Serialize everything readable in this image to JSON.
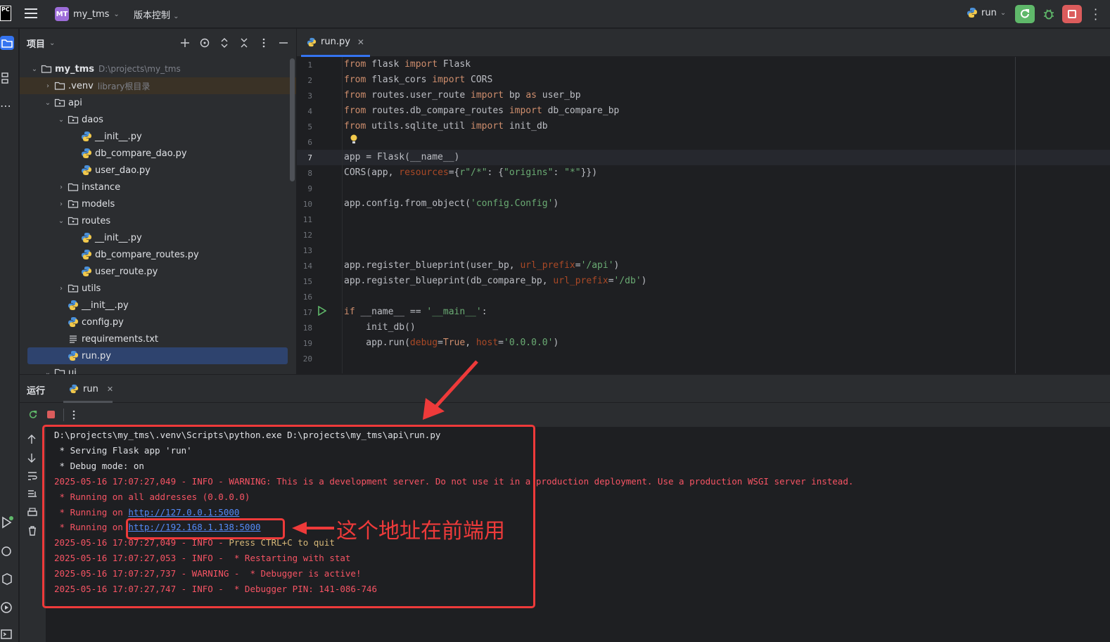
{
  "titlebar": {
    "logo": "PC",
    "project_badge": "MT",
    "project_name": "my_tms",
    "vcs_label": "版本控制",
    "run_config": "run"
  },
  "project_panel": {
    "title": "项目",
    "tree": [
      {
        "label": "my_tms",
        "hint": "D:\\projects\\my_tms",
        "depth": 0,
        "type": "folder",
        "open": true,
        "bold": true
      },
      {
        "label": ".venv",
        "hint": "library根目录",
        "depth": 1,
        "type": "folder",
        "open": false
      },
      {
        "label": "api",
        "hint": "",
        "depth": 1,
        "type": "package",
        "open": true
      },
      {
        "label": "daos",
        "hint": "",
        "depth": 2,
        "type": "package",
        "open": true
      },
      {
        "label": "__init__.py",
        "hint": "",
        "depth": 3,
        "type": "py"
      },
      {
        "label": "db_compare_dao.py",
        "hint": "",
        "depth": 3,
        "type": "py"
      },
      {
        "label": "user_dao.py",
        "hint": "",
        "depth": 3,
        "type": "py"
      },
      {
        "label": "instance",
        "hint": "",
        "depth": 2,
        "type": "folder",
        "open": false
      },
      {
        "label": "models",
        "hint": "",
        "depth": 2,
        "type": "package",
        "open": false
      },
      {
        "label": "routes",
        "hint": "",
        "depth": 2,
        "type": "package",
        "open": true
      },
      {
        "label": "__init__.py",
        "hint": "",
        "depth": 3,
        "type": "py"
      },
      {
        "label": "db_compare_routes.py",
        "hint": "",
        "depth": 3,
        "type": "py"
      },
      {
        "label": "user_route.py",
        "hint": "",
        "depth": 3,
        "type": "py"
      },
      {
        "label": "utils",
        "hint": "",
        "depth": 2,
        "type": "package",
        "open": false
      },
      {
        "label": "__init__.py",
        "hint": "",
        "depth": 2,
        "type": "py"
      },
      {
        "label": "config.py",
        "hint": "",
        "depth": 2,
        "type": "py"
      },
      {
        "label": "requirements.txt",
        "hint": "",
        "depth": 2,
        "type": "txt"
      },
      {
        "label": "run.py",
        "hint": "",
        "depth": 2,
        "type": "py",
        "selected": true
      },
      {
        "label": "ui",
        "hint": "",
        "depth": 1,
        "type": "folder",
        "open": true
      }
    ]
  },
  "editor": {
    "tab_label": "run.py",
    "current_line": 7,
    "lines": [
      [
        [
          "kw",
          "from"
        ],
        [
          "t",
          " flask "
        ],
        [
          "kw",
          "import"
        ],
        [
          "t",
          " Flask"
        ]
      ],
      [
        [
          "kw",
          "from"
        ],
        [
          "t",
          " flask_cors "
        ],
        [
          "kw",
          "import"
        ],
        [
          "t",
          " CORS"
        ]
      ],
      [
        [
          "kw",
          "from"
        ],
        [
          "t",
          " routes.user_route "
        ],
        [
          "kw",
          "import"
        ],
        [
          "t",
          " bp "
        ],
        [
          "kw",
          "as"
        ],
        [
          "t",
          " user_bp"
        ]
      ],
      [
        [
          "kw",
          "from"
        ],
        [
          "t",
          " routes.db_compare_routes "
        ],
        [
          "kw",
          "import"
        ],
        [
          "t",
          " db_compare_bp"
        ]
      ],
      [
        [
          "kw",
          "from"
        ],
        [
          "t",
          " utils.sqlite_util "
        ],
        [
          "kw",
          "import"
        ],
        [
          "t",
          " init_db"
        ]
      ],
      [],
      [
        [
          "t",
          "app = Flask(__name__)"
        ]
      ],
      [
        [
          "t",
          "CORS(app, "
        ],
        [
          "prm",
          "resources"
        ],
        [
          "t",
          "={"
        ],
        [
          "str",
          "r\"/*\""
        ],
        [
          "t",
          ": {"
        ],
        [
          "str",
          "\"origins\""
        ],
        [
          "t",
          ": "
        ],
        [
          "str",
          "\"*\""
        ],
        [
          "t",
          "}})"
        ]
      ],
      [],
      [
        [
          "t",
          "app.config.from_object("
        ],
        [
          "str",
          "'config.Config'"
        ],
        [
          "t",
          ")"
        ]
      ],
      [],
      [],
      [],
      [
        [
          "t",
          "app.register_blueprint(user_bp, "
        ],
        [
          "prm",
          "url_prefix"
        ],
        [
          "t",
          "="
        ],
        [
          "str",
          "'/api'"
        ],
        [
          "t",
          ")"
        ]
      ],
      [
        [
          "t",
          "app.register_blueprint(db_compare_bp, "
        ],
        [
          "prm",
          "url_prefix"
        ],
        [
          "t",
          "="
        ],
        [
          "str",
          "'/db'"
        ],
        [
          "t",
          ")"
        ]
      ],
      [],
      [
        [
          "kw",
          "if"
        ],
        [
          "t",
          " __name__ == "
        ],
        [
          "str",
          "'__main__'"
        ],
        [
          "t",
          ":"
        ]
      ],
      [
        [
          "t",
          "    init_db()"
        ]
      ],
      [
        [
          "t",
          "    app.run("
        ],
        [
          "prm",
          "debug"
        ],
        [
          "t",
          "="
        ],
        [
          "kw",
          "True"
        ],
        [
          "t",
          ", "
        ],
        [
          "prm",
          "host"
        ],
        [
          "t",
          "="
        ],
        [
          "str",
          "'0.0.0.0'"
        ],
        [
          "t",
          ")"
        ]
      ],
      []
    ]
  },
  "run_panel": {
    "title": "运行",
    "tab_label": "run",
    "console": [
      [
        [
          "white",
          "D:\\projects\\my_tms\\.venv\\Scripts\\python.exe D:\\projects\\my_tms\\api\\run.py"
        ]
      ],
      [
        [
          "white",
          " * Serving Flask app 'run'"
        ]
      ],
      [
        [
          "white",
          " * Debug mode: on"
        ]
      ],
      [
        [
          "red",
          "2025-05-16 17:07:27,049 - INFO - WARNING: This is a development server. Do not use it in a production deployment. Use a production WSGI server instead."
        ]
      ],
      [
        [
          "red",
          " * Running on all addresses (0.0.0.0)"
        ]
      ],
      [
        [
          "red",
          " * Running on "
        ],
        [
          "link",
          "http://127.0.0.1:5000"
        ]
      ],
      [
        [
          "red",
          " * Running on "
        ],
        [
          "link",
          "http://192.168.1.138:5000"
        ]
      ],
      [
        [
          "red",
          "2025-05-16 17:07:27,049 - INFO - "
        ],
        [
          "yellow",
          "Press CTRL+C to quit"
        ]
      ],
      [
        [
          "red",
          "2025-05-16 17:07:27,053 - INFO -  * Restarting with stat"
        ]
      ],
      [
        [
          "red",
          "2025-05-16 17:07:27,737 - WARNING -  * Debugger is active!"
        ]
      ],
      [
        [
          "red",
          "2025-05-16 17:07:27,747 - INFO -  * Debugger PIN: 141-086-746"
        ]
      ]
    ]
  },
  "annotation": {
    "text": "这个地址在前端用",
    "color": "#ee3a3a"
  },
  "colors": {
    "accent": "#3574f0",
    "keyword": "#cf8e6d",
    "string": "#6aab73",
    "param": "#aa4926",
    "console_error": "#f75464",
    "link": "#548af7"
  }
}
